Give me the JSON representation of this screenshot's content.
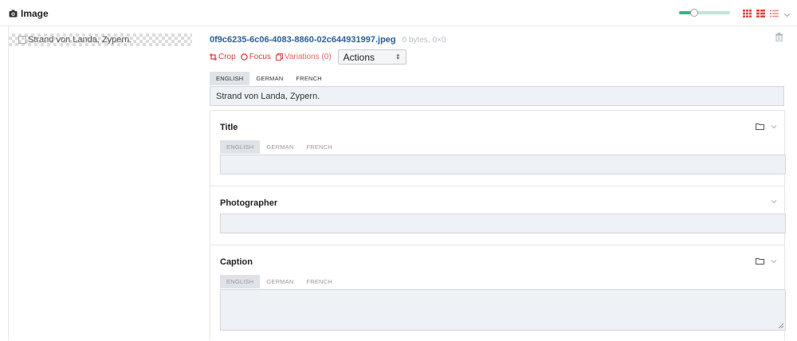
{
  "header": {
    "title": "Image",
    "camera_icon": "camera-icon",
    "view_icons": [
      "grid-small-icon",
      "grid-large-icon",
      "list-icon"
    ],
    "zoom_slider_fraction": 0.3,
    "accent": "#d9413b",
    "slider_color": "#32b48c"
  },
  "preview": {
    "alt_text": "Strand von Landa, Zypern."
  },
  "file": {
    "name": "0f9c6235-6c06-4083-8860-02c644931997.jpeg",
    "meta": "0 bytes, 0×0"
  },
  "actions": {
    "crop": "Crop",
    "focus": "Focus",
    "variations": "Variations (0)",
    "select_value": "Actions"
  },
  "languages": [
    "ENGLISH",
    "GERMAN",
    "FRENCH"
  ],
  "alt_field": {
    "value": "Strand von Landa, Zypern."
  },
  "fields": {
    "title": {
      "label": "Title",
      "tabs": [
        "ENGLISH",
        "GERMAN",
        "FRENCH"
      ]
    },
    "photographer": {
      "label": "Photographer"
    },
    "caption": {
      "label": "Caption",
      "tabs": [
        "ENGLISH",
        "GERMAN",
        "FRENCH"
      ]
    }
  }
}
